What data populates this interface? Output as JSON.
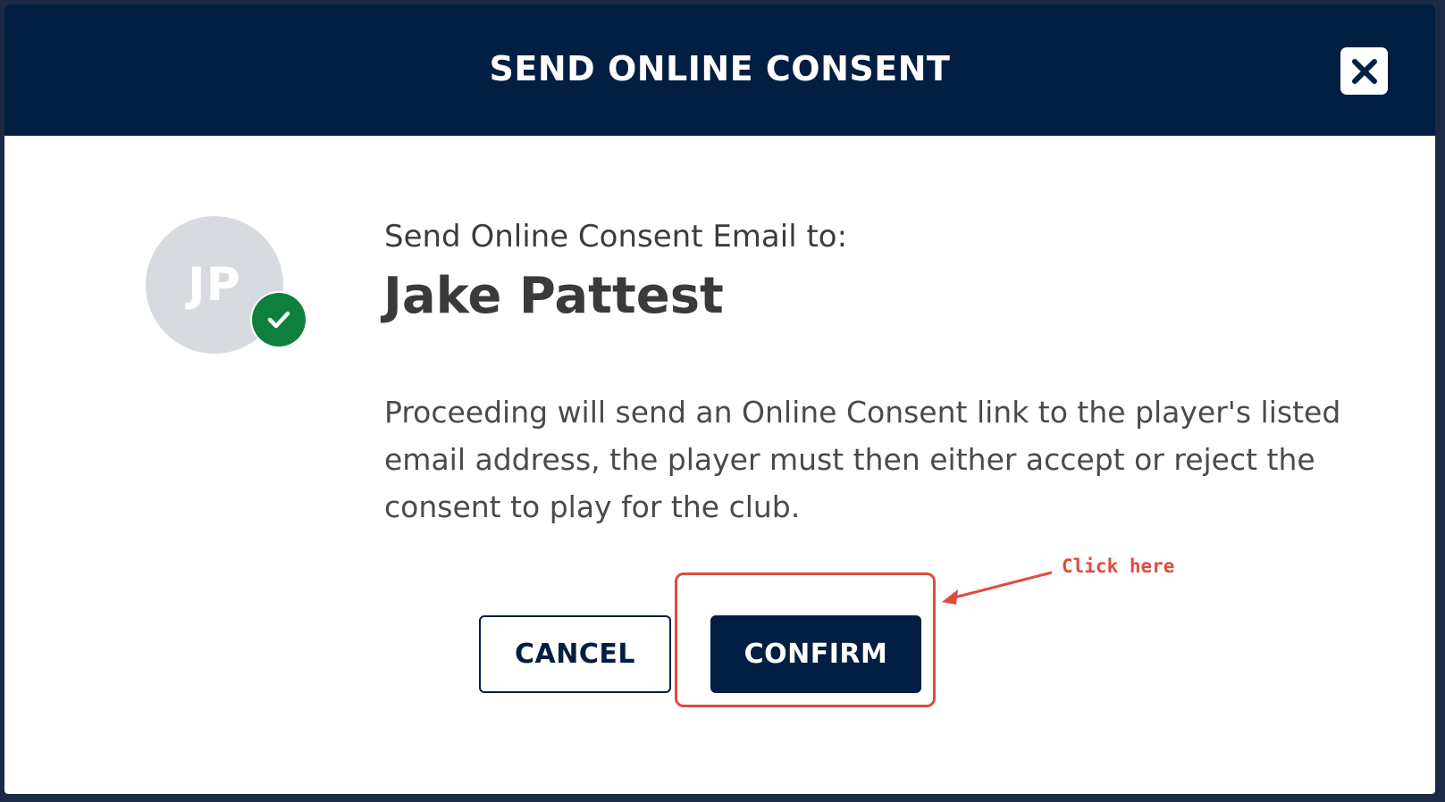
{
  "modal": {
    "title": "SEND ONLINE CONSENT",
    "close_icon": "close-icon"
  },
  "player": {
    "initials": "JP",
    "status_icon": "check-icon",
    "status_color": "#0f7f3d",
    "subtitle": "Send Online Consent Email to:",
    "name": "Jake Pattest"
  },
  "description": "Proceeding will send an Online Consent link to the player's listed email address, the player must then either accept or reject the consent to play for the club.",
  "actions": {
    "cancel_label": "CANCEL",
    "confirm_label": "CONFIRM"
  },
  "annotation": {
    "text": "Click here",
    "color": "#e04b3c"
  },
  "colors": {
    "header": "#021e42",
    "primary": "#021e42"
  }
}
